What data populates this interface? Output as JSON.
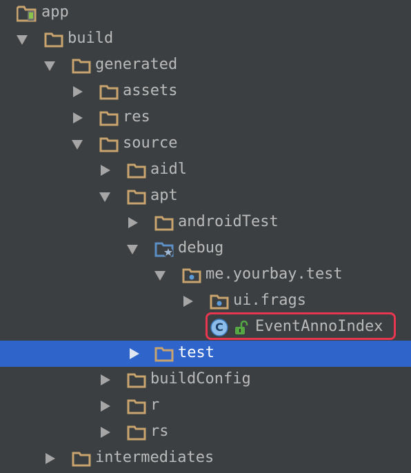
{
  "tree": {
    "app": "app",
    "build": "build",
    "generated": "generated",
    "assets": "assets",
    "res": "res",
    "source": "source",
    "aidl": "aidl",
    "apt": "apt",
    "androidTest": "androidTest",
    "debug": "debug",
    "package_main": "me.yourbay.test",
    "package_sub": "ui.frags",
    "class_file": "EventAnnoIndex",
    "class_badge": "C",
    "test": "test",
    "buildConfig": "buildConfig",
    "r": "r",
    "rs": "rs",
    "intermediates": "intermediates"
  },
  "colors": {
    "background": "#3c3f41",
    "selection": "#2f65ca",
    "folder": "#c9a46f",
    "highlight": "#e8364f",
    "text": "#bbbbbb"
  },
  "icons": {
    "app": "android-module-icon",
    "folder": "folder-icon",
    "debug": "generated-sources-folder-icon",
    "package": "package-icon",
    "class": "class-icon",
    "lock": "unlocked-icon"
  }
}
